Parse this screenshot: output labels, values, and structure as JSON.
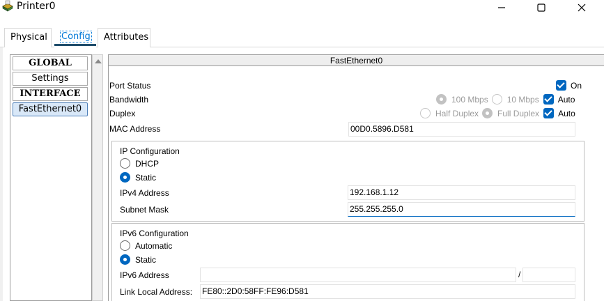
{
  "window": {
    "title": "Printer0",
    "icon": "printer-icon",
    "controls": [
      "minimize-icon",
      "maximize-icon",
      "close-icon"
    ]
  },
  "tabs": {
    "physical": "Physical",
    "config": "Config",
    "attributes": "Attributes",
    "active": "Config"
  },
  "nav": {
    "global": "GLOBAL",
    "settings": "Settings",
    "interface": "INTERFACE",
    "fastethernet": "FastEthernet0",
    "selected": "FastEthernet0"
  },
  "panel": {
    "title": "FastEthernet0",
    "port_status": {
      "label": "Port Status",
      "checkbox_label": "On",
      "checked": true
    },
    "bandwidth": {
      "label": "Bandwidth",
      "option_100": "100 Mbps",
      "option_10": "10 Mbps",
      "auto_label": "Auto",
      "auto_checked": true
    },
    "duplex": {
      "label": "Duplex",
      "option_half": "Half Duplex",
      "option_full": "Full Duplex",
      "auto_label": "Auto",
      "auto_checked": true
    },
    "mac": {
      "label": "MAC Address",
      "value": "00D0.5896.D581"
    }
  },
  "ip_config": {
    "title": "IP Configuration",
    "dhcp": "DHCP",
    "static": "Static",
    "selected": "Static",
    "ipv4_label": "IPv4 Address",
    "ipv4_value": "192.168.1.12",
    "mask_label": "Subnet Mask",
    "mask_value": "255.255.255.0"
  },
  "ipv6_config": {
    "title": "IPv6 Configuration",
    "automatic": "Automatic",
    "static": "Static",
    "selected": "Static",
    "ipv6_label": "IPv6 Address",
    "ipv6_value": "",
    "prefix_sep": "/",
    "prefix_value": "",
    "link_local_label": "Link Local Address:",
    "link_local_value": "FE80::2D0:58FF:FE96:D581"
  },
  "colors": {
    "accent": "#0067c0",
    "tab_underline": "#1f4d6b",
    "nav_selected": "#d9e8f8"
  }
}
